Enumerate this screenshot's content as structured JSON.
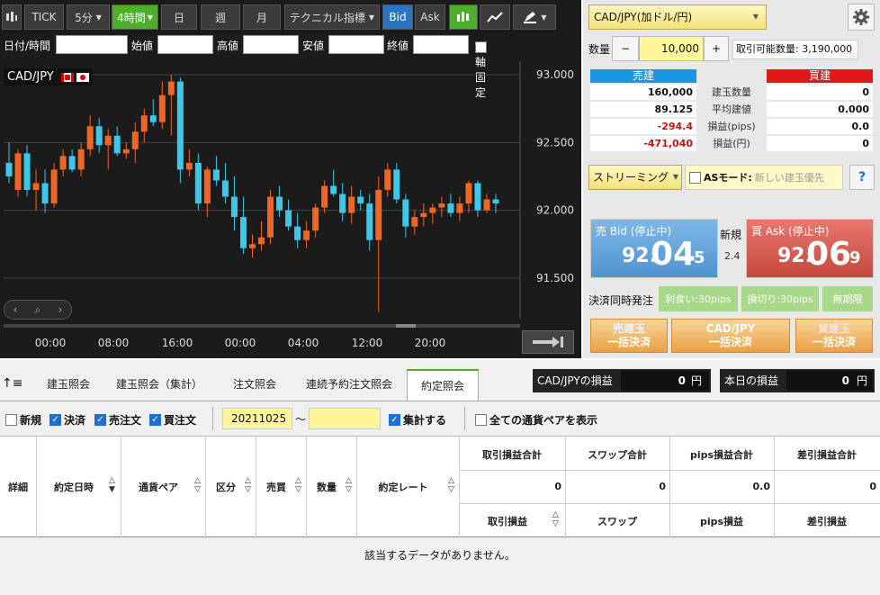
{
  "toolbar": {
    "tick": "TICK",
    "interval_5m": "5分",
    "interval_4h": "4時間",
    "day": "日",
    "week": "週",
    "month": "月",
    "technical": "テクニカル指標",
    "bid": "Bid",
    "ask": "Ask"
  },
  "filter": {
    "datetime": "日付/時間",
    "open": "始値",
    "high": "高値",
    "low": "安値",
    "close": "終値",
    "y_fixed": "Y軸固定"
  },
  "chart_label": "CAD/JPY",
  "chart_data": {
    "type": "candlestick",
    "pair": "CAD/JPY",
    "y_ticks": [
      "93.000",
      "92.500",
      "92.000",
      "91.500"
    ],
    "ylim": [
      91.2,
      93.1
    ],
    "x_ticks": [
      "00:00",
      "08:00",
      "16:00",
      "00:00",
      "04:00",
      "12:00",
      "20:00"
    ],
    "candles": [
      {
        "o": 92.35,
        "h": 92.5,
        "l": 92.2,
        "c": 92.25
      },
      {
        "o": 92.15,
        "h": 92.45,
        "l": 92.1,
        "c": 92.42
      },
      {
        "o": 92.42,
        "h": 92.48,
        "l": 92.1,
        "c": 92.15
      },
      {
        "o": 92.15,
        "h": 92.3,
        "l": 92.0,
        "c": 92.2
      },
      {
        "o": 92.2,
        "h": 92.3,
        "l": 91.98,
        "c": 92.05
      },
      {
        "o": 92.05,
        "h": 92.35,
        "l": 92.02,
        "c": 92.3
      },
      {
        "o": 92.3,
        "h": 92.45,
        "l": 92.25,
        "c": 92.4
      },
      {
        "o": 92.4,
        "h": 92.45,
        "l": 92.28,
        "c": 92.3
      },
      {
        "o": 92.3,
        "h": 92.5,
        "l": 92.25,
        "c": 92.45
      },
      {
        "o": 92.45,
        "h": 92.7,
        "l": 92.4,
        "c": 92.62
      },
      {
        "o": 92.62,
        "h": 92.68,
        "l": 92.42,
        "c": 92.48
      },
      {
        "o": 92.48,
        "h": 92.6,
        "l": 92.3,
        "c": 92.55
      },
      {
        "o": 92.55,
        "h": 92.62,
        "l": 92.4,
        "c": 92.42
      },
      {
        "o": 92.42,
        "h": 92.5,
        "l": 92.38,
        "c": 92.45
      },
      {
        "o": 92.45,
        "h": 92.65,
        "l": 92.35,
        "c": 92.58
      },
      {
        "o": 92.58,
        "h": 92.75,
        "l": 92.5,
        "c": 92.7
      },
      {
        "o": 92.7,
        "h": 92.82,
        "l": 92.62,
        "c": 92.65
      },
      {
        "o": 92.65,
        "h": 92.95,
        "l": 92.6,
        "c": 92.85
      },
      {
        "o": 92.85,
        "h": 93.0,
        "l": 92.55,
        "c": 92.95
      },
      {
        "o": 92.95,
        "h": 92.98,
        "l": 92.2,
        "c": 92.3
      },
      {
        "o": 92.3,
        "h": 92.45,
        "l": 92.25,
        "c": 92.35
      },
      {
        "o": 92.35,
        "h": 92.42,
        "l": 92.0,
        "c": 92.05
      },
      {
        "o": 92.05,
        "h": 92.32,
        "l": 91.95,
        "c": 92.3
      },
      {
        "o": 92.3,
        "h": 92.4,
        "l": 92.18,
        "c": 92.22
      },
      {
        "o": 92.22,
        "h": 92.35,
        "l": 92.05,
        "c": 92.1
      },
      {
        "o": 92.1,
        "h": 92.25,
        "l": 91.85,
        "c": 91.95
      },
      {
        "o": 91.95,
        "h": 92.1,
        "l": 91.68,
        "c": 91.72
      },
      {
        "o": 91.72,
        "h": 91.82,
        "l": 91.65,
        "c": 91.75
      },
      {
        "o": 91.75,
        "h": 91.92,
        "l": 91.7,
        "c": 91.8
      },
      {
        "o": 91.8,
        "h": 92.15,
        "l": 91.75,
        "c": 92.1
      },
      {
        "o": 92.1,
        "h": 92.18,
        "l": 91.95,
        "c": 92.0
      },
      {
        "o": 92.0,
        "h": 92.08,
        "l": 91.85,
        "c": 91.88
      },
      {
        "o": 91.88,
        "h": 91.98,
        "l": 91.72,
        "c": 91.78
      },
      {
        "o": 91.78,
        "h": 91.92,
        "l": 91.72,
        "c": 91.85
      },
      {
        "o": 91.85,
        "h": 92.05,
        "l": 91.8,
        "c": 92.02
      },
      {
        "o": 92.02,
        "h": 92.22,
        "l": 91.98,
        "c": 92.18
      },
      {
        "o": 92.18,
        "h": 92.3,
        "l": 92.1,
        "c": 92.12
      },
      {
        "o": 92.12,
        "h": 92.2,
        "l": 91.92,
        "c": 91.98
      },
      {
        "o": 91.98,
        "h": 92.18,
        "l": 91.9,
        "c": 92.1
      },
      {
        "o": 92.1,
        "h": 92.15,
        "l": 92.0,
        "c": 92.05
      },
      {
        "o": 92.05,
        "h": 92.12,
        "l": 91.7,
        "c": 91.78
      },
      {
        "o": 91.78,
        "h": 92.25,
        "l": 91.25,
        "c": 92.15
      },
      {
        "o": 92.15,
        "h": 92.35,
        "l": 92.1,
        "c": 92.3
      },
      {
        "o": 92.3,
        "h": 92.35,
        "l": 92.05,
        "c": 92.08
      },
      {
        "o": 92.08,
        "h": 92.12,
        "l": 91.8,
        "c": 91.88
      },
      {
        "o": 91.88,
        "h": 92.0,
        "l": 91.82,
        "c": 91.95
      },
      {
        "o": 91.95,
        "h": 92.05,
        "l": 91.88,
        "c": 91.98
      },
      {
        "o": 91.98,
        "h": 92.05,
        "l": 91.9,
        "c": 92.02
      },
      {
        "o": 92.02,
        "h": 92.1,
        "l": 91.95,
        "c": 92.05
      },
      {
        "o": 92.05,
        "h": 92.12,
        "l": 91.95,
        "c": 91.98
      },
      {
        "o": 91.98,
        "h": 92.1,
        "l": 91.92,
        "c": 92.05
      },
      {
        "o": 92.05,
        "h": 92.22,
        "l": 91.98,
        "c": 92.2
      },
      {
        "o": 92.2,
        "h": 92.22,
        "l": 91.95,
        "c": 92.0
      },
      {
        "o": 92.0,
        "h": 92.12,
        "l": 91.98,
        "c": 92.08
      },
      {
        "o": 92.08,
        "h": 92.12,
        "l": 91.98,
        "c": 92.05
      }
    ]
  },
  "side": {
    "pair_select": "CAD/JPY(加ドル/円)",
    "quantity_label": "数量",
    "minus": "−",
    "quantity": "10,000",
    "plus": "+",
    "available": "取引可能数量: 3,190,000",
    "sell_header": "売建",
    "buy_header": "買建",
    "rows": [
      {
        "label": "建玉数量",
        "sell": "160,000",
        "buy": "0",
        "sell_red": false
      },
      {
        "label": "平均建値",
        "sell": "89.125",
        "buy": "0.000",
        "sell_red": false
      },
      {
        "label": "損益(pips)",
        "sell": "-294.4",
        "buy": "0.0",
        "sell_red": true
      },
      {
        "label": "損益(円)",
        "sell": "-471,040",
        "buy": "0",
        "sell_red": true
      }
    ],
    "streaming": "ストリーミング",
    "as_mode": "ASモード:",
    "as_mode_value": "新しい建玉優先",
    "help": "?",
    "bid_label": "売 Bid (停止中)",
    "bid_main": "92.",
    "bid_big": "04",
    "bid_small": "5",
    "new_label": "新規",
    "spread": "2.4",
    "ask_label": "買 Ask (停止中)",
    "ask_main": "92.",
    "ask_big": "06",
    "ask_small": "9",
    "settle_label": "決済同時発注",
    "take_profit": "利食い:30pips",
    "stop_loss": "損切り:30pips",
    "unlimited": "無期限",
    "sell_settle_1": "売建玉",
    "sell_settle_2": "一括決済",
    "pair_settle_1": "CAD/JPY",
    "pair_settle_2": "一括決済",
    "buy_settle_1": "買建玉",
    "buy_settle_2": "一括決済"
  },
  "tabs": [
    "建玉照会",
    "建玉照会（集計）",
    "注文照会",
    "連続予約注文照会",
    "約定照会"
  ],
  "pnl": {
    "pair_label": "CAD/JPYの損益",
    "pair_value": "0",
    "pair_unit": "円",
    "today_label": "本日の損益",
    "today_value": "0",
    "today_unit": "円"
  },
  "filters": {
    "new": "新規",
    "settle": "決済",
    "sell_order": "売注文",
    "buy_order": "買注文",
    "date_from": "20211025",
    "tilde": "〜",
    "aggregate": "集計する",
    "show_all": "全ての通貨ペアを表示"
  },
  "table": {
    "detail": "詳細",
    "exec_time": "約定日時",
    "pair": "通貨ペア",
    "category": "区分",
    "side": "売買",
    "qty": "数量",
    "rate": "約定レート",
    "total_pnl": "取引損益合計",
    "swap_total": "スワップ合計",
    "pips_total": "pips損益合計",
    "net_total": "差引損益合計",
    "total_pnl_val": "0",
    "swap_total_val": "0",
    "pips_total_val": "0.0",
    "net_total_val": "0",
    "pnl": "取引損益",
    "swap": "スワップ",
    "pips": "pips損益",
    "net": "差引損益",
    "empty": "該当するデータがありません。"
  }
}
